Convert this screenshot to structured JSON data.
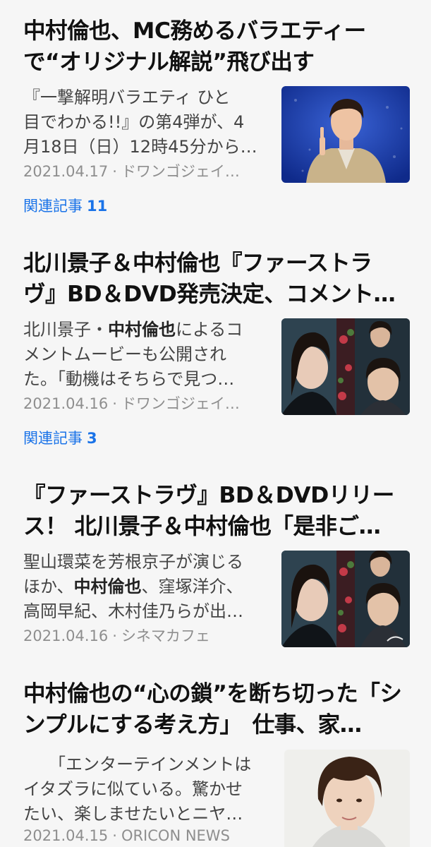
{
  "articles": [
    {
      "title_lines": [
        "中村倫也、MC務めるバラエティー",
        "で“オリジナル解説”飛び出す"
      ],
      "summary_lines": [
        "『一撃解明バラエティ ひと",
        "目でわかる!!』の第4弾が、4",
        "月18日（日）12時45分から…"
      ],
      "date": "2021.04.17",
      "source": "ドワンゴジェイ…",
      "related_label": "関連記事",
      "related_count": "11"
    },
    {
      "title_lines": [
        "北川景子＆中村倫也『ファーストラ",
        "ヴ』BD＆DVD発売決定、コメント…"
      ],
      "summary_lines": [
        "北川景子・",
        "中村倫也",
        "によるコ",
        "メントムービーも公開され",
        "た。「動機はそちらで見つ…"
      ],
      "date": "2021.04.16",
      "source": "ドワンゴジェイ…",
      "related_label": "関連記事",
      "related_count": "3"
    },
    {
      "title_lines": [
        "『ファーストラヴ』BD＆DVDリリー",
        "ス！ 北川景子＆中村倫也「是非ご…"
      ],
      "summary_lines": [
        "聖山環菜を芳根京子が演じる",
        "ほか、",
        "中村倫也",
        "、窪塚洋介、",
        "高岡早紀、木村佳乃らが出…"
      ],
      "date": "2021.04.16",
      "source": "シネマカフェ"
    },
    {
      "title_lines": [
        "中村倫也の“心の鎖”を断ち切った「シ",
        "ンプルにする考え方」　仕事、家…"
      ],
      "summary_lines": [
        "「エンターテインメントは",
        "イタズラに似ている。驚かせ",
        "たい、楽しませたいとニヤ…"
      ],
      "date": "2021.04.15",
      "source": "ORICON NEWS"
    }
  ],
  "separator": "·"
}
